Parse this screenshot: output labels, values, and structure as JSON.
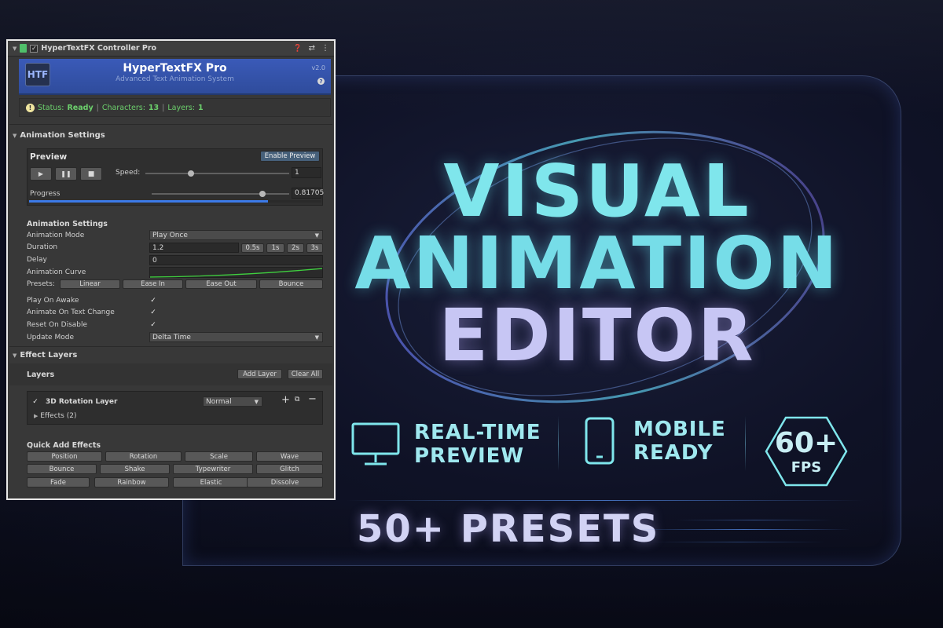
{
  "inspector": {
    "component_title": "HyperTextFX Controller Pro",
    "banner": {
      "logo": "HTF",
      "title": "HyperTextFX Pro",
      "subtitle": "Advanced Text Animation System",
      "version": "v2.0",
      "help": "?"
    },
    "status": {
      "status_label": "Status:",
      "status_value": "Ready",
      "characters_label": "Characters:",
      "characters_value": "13",
      "layers_label": "Layers:",
      "layers_value": "1"
    },
    "animation_settings_header": "Animation Settings",
    "preview": {
      "title": "Preview",
      "enable_button": "Enable Preview",
      "speed_label": "Speed:",
      "speed_value": "1",
      "progress_label": "Progress",
      "progress_value": "0.81705",
      "progress_fraction": 0.817
    },
    "settings": {
      "sub_header": "Animation Settings",
      "animation_mode_label": "Animation Mode",
      "animation_mode_value": "Play Once",
      "duration_label": "Duration",
      "duration_value": "1.2",
      "duration_presets": [
        "0.5s",
        "1s",
        "2s",
        "3s"
      ],
      "delay_label": "Delay",
      "delay_value": "0",
      "curve_label": "Animation Curve",
      "presets_label": "Presets:",
      "curve_presets": [
        "Linear",
        "Ease In",
        "Ease Out",
        "Bounce"
      ],
      "play_on_awake_label": "Play On Awake",
      "animate_on_text_change_label": "Animate On Text Change",
      "reset_on_disable_label": "Reset On Disable",
      "update_mode_label": "Update Mode",
      "update_mode_value": "Delta Time"
    },
    "effect_layers": {
      "header": "Effect Layers",
      "layers_label": "Layers",
      "add_layer_button": "Add Layer",
      "clear_all_button": "Clear All",
      "layer_name": "3D Rotation Layer",
      "blend_mode": "Normal",
      "effects_label": "Effects (2)"
    },
    "quick_add": {
      "header": "Quick Add Effects",
      "row1": [
        "Position",
        "Rotation",
        "Scale",
        "Wave"
      ],
      "row2": [
        "Bounce",
        "Shake",
        "Typewriter",
        "Glitch"
      ],
      "row3": [
        "Fade",
        "Rainbow",
        "Elastic",
        "Dissolve"
      ]
    }
  },
  "hero": {
    "line1": "VISUAL",
    "line2": "ANIMATION",
    "line3": "EDITOR",
    "feature1_line1": "REAL-TIME",
    "feature1_line2": "PREVIEW",
    "feature2_line1": "MOBILE",
    "feature2_line2": "READY",
    "fps_value": "60+",
    "fps_label": "FPS",
    "presets": "50+ PRESETS"
  },
  "colors": {
    "accent_cyan": "#7fe6ec",
    "accent_lavender": "#c7c6f4",
    "banner_blue": "#3a5ab8",
    "status_green": "#6cd06c"
  }
}
